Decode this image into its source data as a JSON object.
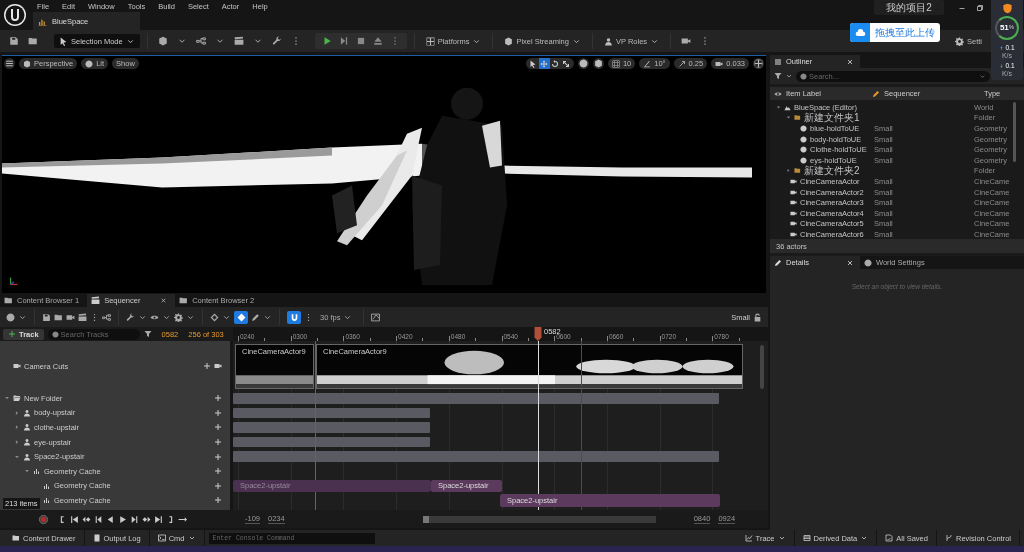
{
  "title_bar": {
    "menu": [
      "File",
      "Edit",
      "Window",
      "Tools",
      "Build",
      "Select",
      "Actor",
      "Help"
    ],
    "tabs": [
      {
        "label": "BlueSpace",
        "selected": true
      }
    ],
    "project": "我的项目2"
  },
  "toolbar": {
    "mode": "Selection Mode",
    "menus": [
      "Platforms",
      "Pixel Streaming",
      "VP Roles"
    ],
    "settings": "Setti"
  },
  "viewport": {
    "menus": [
      "Perspective",
      "Lit",
      "Show"
    ],
    "transform_tools": [
      {
        "kind": "select",
        "selected": false
      },
      {
        "kind": "move",
        "selected": true
      },
      {
        "kind": "rotate",
        "selected": false
      },
      {
        "kind": "scale",
        "selected": false
      }
    ],
    "grid_snap": "10",
    "rotation_snap": "10°",
    "scale_snap": "0.25",
    "camera_speed": "0.033"
  },
  "dock_tabs": [
    {
      "label": "Content Browser 1",
      "selected": false
    },
    {
      "label": "Sequencer",
      "selected": true
    },
    {
      "label": "Content Browser 2",
      "selected": false
    }
  ],
  "sequencer": {
    "auto_key": true,
    "snap": true,
    "fps": "30 fps",
    "size": "Small",
    "add_track": "Track",
    "search_placeholder": "Search Tracks",
    "current_frame": "0582",
    "count": "256 of 303",
    "ticks": [
      "0240",
      "0300",
      "0360",
      "0420",
      "0480",
      "0540",
      "0600",
      "0660",
      "0720",
      "0780"
    ],
    "playhead": "0582",
    "tracks": [
      {
        "kind": "camera_cuts",
        "label": "Camera Cuts",
        "clips": [
          {
            "label": "CineCameraActor9"
          },
          {
            "label": "CineCameraActor9"
          }
        ]
      },
      {
        "kind": "folder",
        "label": "New Folder",
        "expanded": true,
        "children": [
          {
            "kind": "actor",
            "label": "body-upstair",
            "expanded": false
          },
          {
            "kind": "actor",
            "label": "clothe-upstair",
            "expanded": false
          },
          {
            "kind": "actor",
            "label": "eye-upstair",
            "expanded": false
          },
          {
            "kind": "actor",
            "label": "Space2-upstair",
            "expanded": true,
            "children": [
              {
                "kind": "geometry_cache",
                "label": "Geometry Cache",
                "expanded": true,
                "children": [
                  {
                    "kind": "geometry_cache",
                    "label": "Geometry Cache",
                    "clips": [
                      {
                        "label": "Space2-upstair",
                        "dimmed": true
                      },
                      {
                        "label": "Space2-upstair",
                        "dimmed": false
                      }
                    ]
                  },
                  {
                    "kind": "geometry_cache",
                    "label": "Geometry Cache",
                    "clips": [
                      {
                        "label": "Space2-upstair",
                        "dimmed": false
                      }
                    ]
                  }
                ]
              }
            ]
          }
        ]
      }
    ],
    "items_tooltip": "213 items",
    "range_start": "-109",
    "view_start": "0234",
    "view_end": "0840",
    "range_end": "0924"
  },
  "outliner": {
    "title": "Outliner",
    "search_placeholder": "Search...",
    "columns": [
      "Item Label",
      "Sequencer",
      "Type"
    ],
    "items": [
      {
        "kind": "world",
        "label": "BlueSpace (Editor)",
        "type": "World",
        "expanded": true,
        "children": [
          {
            "kind": "folder",
            "label": "新建文件夹1",
            "type": "Folder",
            "expanded": true,
            "children": [
              {
                "kind": "geometry",
                "label": "blue-holdToUE",
                "sequencer": "Small",
                "type": "Geometry"
              },
              {
                "kind": "geometry",
                "label": "body-holdToUE",
                "sequencer": "Small",
                "type": "Geometry"
              },
              {
                "kind": "geometry",
                "label": "Clothe-holdToUE",
                "sequencer": "Small",
                "type": "Geometry"
              },
              {
                "kind": "geometry",
                "label": "eys-holdToUE",
                "sequencer": "Small",
                "type": "Geometry"
              }
            ]
          },
          {
            "kind": "folder",
            "label": "新建文件夹2",
            "type": "Folder",
            "expanded": false
          },
          {
            "kind": "camera",
            "label": "CineCameraActor",
            "sequencer": "Small",
            "type": "CineCame"
          },
          {
            "kind": "camera",
            "label": "CineCameraActor2",
            "sequencer": "Small",
            "type": "CineCame"
          },
          {
            "kind": "camera",
            "label": "CineCameraActor3",
            "sequencer": "Small",
            "type": "CineCame"
          },
          {
            "kind": "camera",
            "label": "CineCameraActor4",
            "sequencer": "Small",
            "type": "CineCame"
          },
          {
            "kind": "camera",
            "label": "CineCameraActor5",
            "sequencer": "Small",
            "type": "CineCame"
          },
          {
            "kind": "camera",
            "label": "CineCameraActor6",
            "sequencer": "Small",
            "type": "CineCame"
          }
        ]
      }
    ],
    "count": "36 actors"
  },
  "details": {
    "tabs": [
      {
        "label": "Details",
        "selected": true
      },
      {
        "label": "World Settings",
        "selected": false
      }
    ],
    "hint": "Select an object to view details."
  },
  "status_bar": {
    "left": [
      "Content Drawer",
      "Output Log"
    ],
    "cmd": "Cmd",
    "console_placeholder": "Enter Console Command",
    "right": [
      "Trace",
      "Derived Data",
      "All Saved",
      "Revision Control"
    ]
  },
  "upload_widget": {
    "label": "拖拽至此上传"
  },
  "net_monitor": {
    "percent": "51",
    "unit": "%",
    "upload": "0.1",
    "upload_unit": "K/s",
    "download": "0.1",
    "download_unit": "K/s"
  }
}
